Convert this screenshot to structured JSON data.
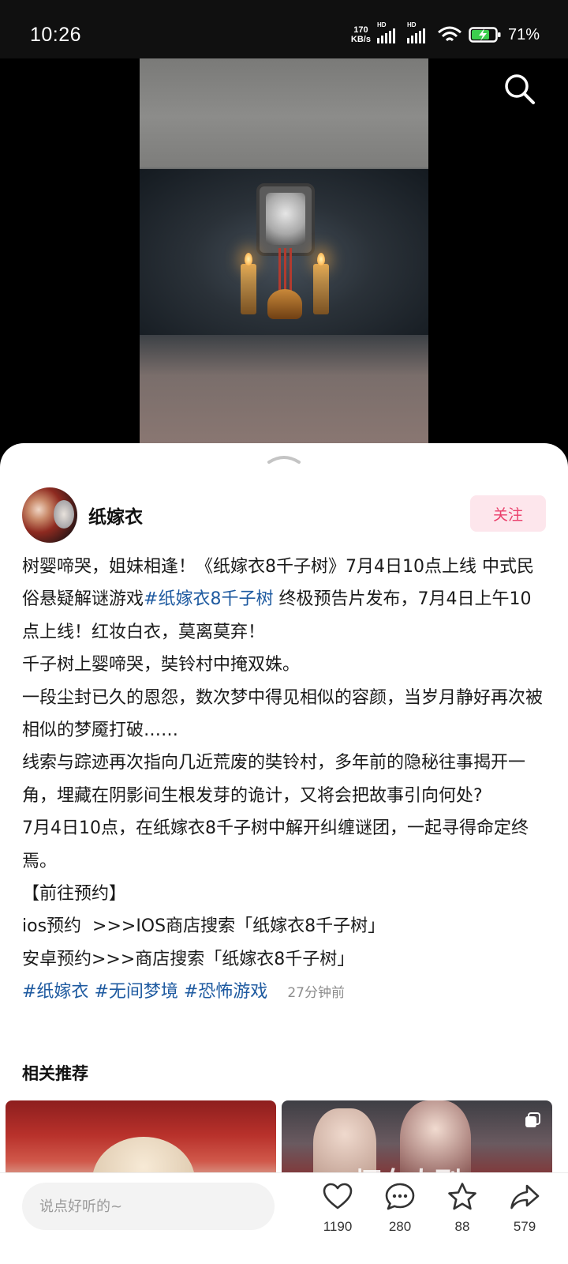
{
  "status_bar": {
    "time": "10:26",
    "net_speed_value": "170",
    "net_speed_unit": "KB/s",
    "signal_badge": "HD",
    "battery_percent": "71%"
  },
  "author": {
    "name": "纸嫁衣",
    "follow_label": "关注"
  },
  "description": {
    "lines": [
      [
        "树婴啼哭，姐妹相逢！《纸嫁衣8千子树》7月4日10点上线 中式民俗悬疑解谜游戏",
        "#纸嫁衣8千子树",
        " 终极预告片发布，7月4日上午10点上线！红妆白衣，莫离莫弃！"
      ],
      "千子树上婴啼哭，奘铃村中掩双姝。",
      "一段尘封已久的恩怨，数次梦中得见相似的容颜，当岁月静好再次被相似的梦魇打破……",
      "线索与踪迹再次指向几近荒废的奘铃村，多年前的隐秘往事揭开一角，埋藏在阴影间生根发芽的诡计，又将会把故事引向何处?",
      "7月4日10点，在纸嫁衣8千子树中解开纠缠谜团，一起寻得命定终焉。",
      "【前往预约】",
      "ios预约  >>>IOS商店搜索「纸嫁衣8千子树」",
      "安卓预约>>>商店搜索「纸嫁衣8千子树」"
    ],
    "tags": [
      "#纸嫁衣",
      "#无间梦境",
      "#恐怖游戏"
    ],
    "time_ago": "27分钟前"
  },
  "related": {
    "title": "相关推荐",
    "card2_overlay": "坏女人刑"
  },
  "bottom_bar": {
    "comment_placeholder": "说点好听的~",
    "likes": "1190",
    "comments": "280",
    "favorites": "88",
    "shares": "579"
  },
  "icons": {
    "search": "search-icon",
    "like": "heart-icon",
    "comment": "comment-bubble-icon",
    "favorite": "star-icon",
    "share": "share-arrow-icon",
    "collapse": "chevron-up-icon",
    "multi_image": "multi-image-icon"
  },
  "colors": {
    "tag_blue": "#1e5aa0",
    "follow_text": "#ea3f6b",
    "follow_bg": "#fde6ec"
  }
}
